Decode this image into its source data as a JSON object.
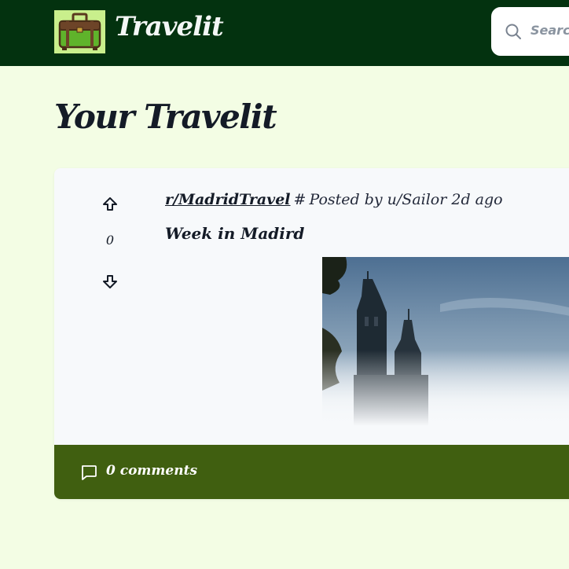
{
  "header": {
    "brand": "Travelit",
    "search_placeholder": "Search"
  },
  "page": {
    "title": "Your Travelit"
  },
  "post": {
    "votes": "0",
    "subreddit": "r/MadridTravel",
    "hash": "#",
    "posted_by": "Posted by u/Sailor 2d ago",
    "title": "Week in Madird",
    "comments_label": "0 comments"
  },
  "colors": {
    "header_bg": "#03320f",
    "page_bg": "#f3fde4",
    "footer_bg": "#405f10"
  }
}
